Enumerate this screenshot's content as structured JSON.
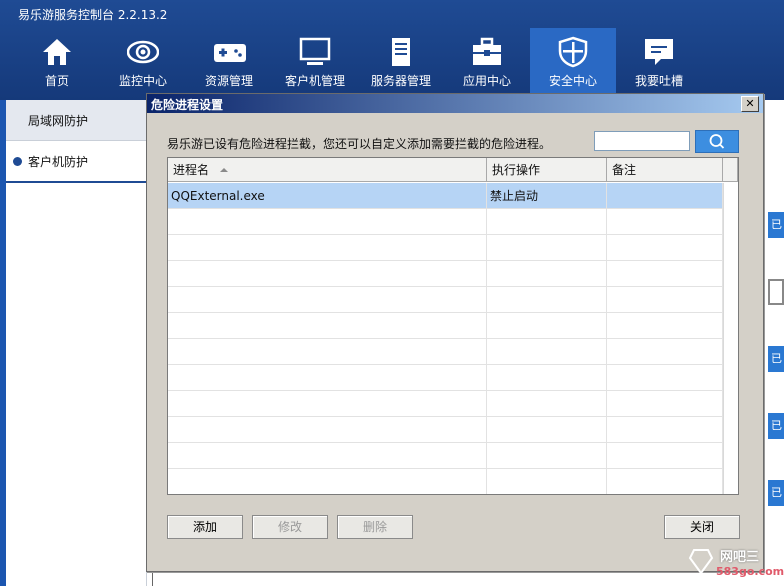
{
  "app": {
    "title": "易乐游服务控制台 2.2.13.2"
  },
  "nav": [
    {
      "label": "首页",
      "icon": "home-icon"
    },
    {
      "label": "监控中心",
      "icon": "eye-icon"
    },
    {
      "label": "资源管理",
      "icon": "gamepad-icon"
    },
    {
      "label": "客户机管理",
      "icon": "monitor-icon"
    },
    {
      "label": "服务器管理",
      "icon": "server-icon"
    },
    {
      "label": "应用中心",
      "icon": "toolbox-icon"
    },
    {
      "label": "安全中心",
      "icon": "shield-icon",
      "active": true
    },
    {
      "label": "我要吐槽",
      "icon": "chat-icon"
    }
  ],
  "sidebar": {
    "items": [
      {
        "label": "局域网防护"
      },
      {
        "label": "客户机防护",
        "active": true
      }
    ]
  },
  "right_stubs": {
    "label": "已"
  },
  "dialog": {
    "title": "危险进程设置",
    "close_label": "✕",
    "description": "易乐游已设有危险进程拦截，您还可以自定义添加需要拦截的危险进程。",
    "search": {
      "value": "",
      "placeholder": ""
    },
    "table": {
      "columns": [
        "进程名",
        "执行操作",
        "备注"
      ],
      "rows": [
        {
          "process": "QQExternal.exe",
          "action": "禁止启动",
          "note": ""
        }
      ]
    },
    "buttons": {
      "add": "添加",
      "edit": "修改",
      "delete": "删除",
      "close": "关闭"
    }
  },
  "watermark": {
    "line1": "网吧三",
    "line2": "583go.com"
  },
  "colors": {
    "topbar": "#1f4b94",
    "active_nav": "#2a69c4",
    "selected_row": "#b6d4f5",
    "search_button": "#3d8ee0"
  }
}
